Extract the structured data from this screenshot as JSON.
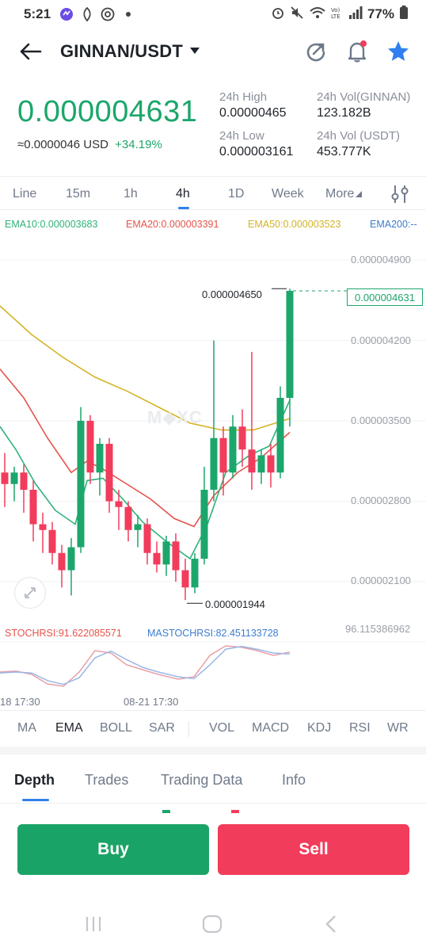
{
  "status_bar": {
    "time": "5:21",
    "battery": "77%"
  },
  "header": {
    "pair": "GINNAN/USDT"
  },
  "ticker": {
    "last_price": "0.000004631",
    "usd_price": "≈0.0000046 USD",
    "change_pct": "+34.19%",
    "high_label": "24h High",
    "high_value": "0.00000465",
    "low_label": "24h Low",
    "low_value": "0.000003161",
    "vol_base_label": "24h Vol(GINNAN)",
    "vol_base_value": "123.182B",
    "vol_quote_label": "24h Vol (USDT)",
    "vol_quote_value": "453.777K"
  },
  "timeframes": [
    "Line",
    "15m",
    "1h",
    "4h",
    "1D",
    "Week",
    "More"
  ],
  "active_timeframe": "4h",
  "ema_legend": [
    {
      "text": "EMA10:0.000003683",
      "color": "#2fb27a"
    },
    {
      "text": "EMA20:0.000003391",
      "color": "#e5534b"
    },
    {
      "text": "EMA50:0.000003523",
      "color": "#d4b324"
    },
    {
      "text": "EMA200:--",
      "color": "#3d7ccf"
    }
  ],
  "chart": {
    "price_levels": [
      "0.000004900",
      "0.000004200",
      "0.000003500",
      "0.000002800",
      "0.000002100"
    ],
    "current_price_tag": "0.000004631",
    "high_marker": "0.000004650",
    "low_marker": "0.000001944",
    "stochrsi_label": "STOCHRSI:91.622085571",
    "mastochrsi_label": "MASTOCHRSI:82.451133728",
    "osc_max": "96.115386962",
    "time_labels": [
      "18 17:30",
      "08-21 17:30"
    ],
    "colors": {
      "up": "#1ca66b",
      "down": "#f23c5c"
    }
  },
  "indicators": [
    "MA",
    "EMA",
    "BOLL",
    "SAR",
    "VOL",
    "MACD",
    "KDJ",
    "RSI",
    "WR"
  ],
  "active_indicator": "EMA",
  "bottom_tabs": [
    "Depth",
    "Trades",
    "Trading Data",
    "Info"
  ],
  "active_bottom_tab": "Depth",
  "actions": {
    "buy": "Buy",
    "sell": "Sell"
  }
}
